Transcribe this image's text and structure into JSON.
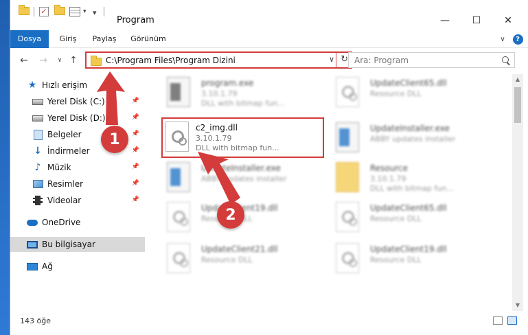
{
  "window": {
    "title": "Program"
  },
  "ribbon": {
    "tabs": [
      "Dosya",
      "Giriş",
      "Paylaş",
      "Görünüm"
    ],
    "active_tab": "Dosya"
  },
  "navbar": {
    "address": "C:\\Program Files\\Program Dizini",
    "search_placeholder": "Ara: Program"
  },
  "sidebar": {
    "items": [
      {
        "label": "Hızlı erişim",
        "icon": "star-icon"
      },
      {
        "label": "Yerel Disk (C:)",
        "icon": "disk-icon"
      },
      {
        "label": "Yerel Disk (D:)",
        "icon": "disk-icon"
      },
      {
        "label": "Belgeler",
        "icon": "documents-icon"
      },
      {
        "label": "İndirmeler",
        "icon": "downloads-icon"
      },
      {
        "label": "Müzik",
        "icon": "music-icon"
      },
      {
        "label": "Resimler",
        "icon": "pictures-icon"
      },
      {
        "label": "Videolar",
        "icon": "videos-icon"
      },
      {
        "label": "OneDrive",
        "icon": "onedrive-icon"
      },
      {
        "label": "Bu bilgisayar",
        "icon": "this-pc-icon"
      },
      {
        "label": "Ağ",
        "icon": "network-icon"
      }
    ],
    "selected": "Bu bilgisayar"
  },
  "files": [
    {
      "name": "program.exe",
      "meta1": "3.10.1.79",
      "meta2": "DLL with bitmap fun...",
      "icon": "exe-icon",
      "blurred": true
    },
    {
      "name": "UpdateClient65.dll",
      "meta1": "Resource DLL",
      "meta2": "",
      "icon": "dll-icon",
      "blurred": true
    },
    {
      "name": "c2_img.dll",
      "meta1": "3.10.1.79",
      "meta2": "DLL with bitmap fun...",
      "icon": "dll-icon",
      "blurred": false
    },
    {
      "name": "UpdateInstaller.exe",
      "meta1": "ABBY updates installer",
      "meta2": "",
      "icon": "exe-icon",
      "blurred": true
    },
    {
      "name": "UpdateInstaller.exe",
      "meta1": "ABBY updates installer",
      "meta2": "",
      "icon": "exe-icon",
      "blurred": true
    },
    {
      "name": "Resource",
      "meta1": "3.10.1.79",
      "meta2": "DLL with bitmap fun...",
      "icon": "folder-icon",
      "blurred": true
    },
    {
      "name": "UpdateClient19.dll",
      "meta1": "Resource DLL",
      "meta2": "",
      "icon": "dll-icon",
      "blurred": true
    },
    {
      "name": "UpdateClient65.dll",
      "meta1": "Resource DLL",
      "meta2": "",
      "icon": "dll-icon",
      "blurred": true
    },
    {
      "name": "UpdateClient21.dll",
      "meta1": "Resource DLL",
      "meta2": "",
      "icon": "dll-icon",
      "blurred": true
    },
    {
      "name": "UpdateClient19.dll",
      "meta1": "Resource DLL",
      "meta2": "",
      "icon": "dll-icon",
      "blurred": true
    }
  ],
  "status": {
    "item_count": "143 öğe"
  },
  "callouts": [
    "1",
    "2"
  ],
  "colors": {
    "accent": "#1a6fc4",
    "highlight": "#d43b3b"
  }
}
